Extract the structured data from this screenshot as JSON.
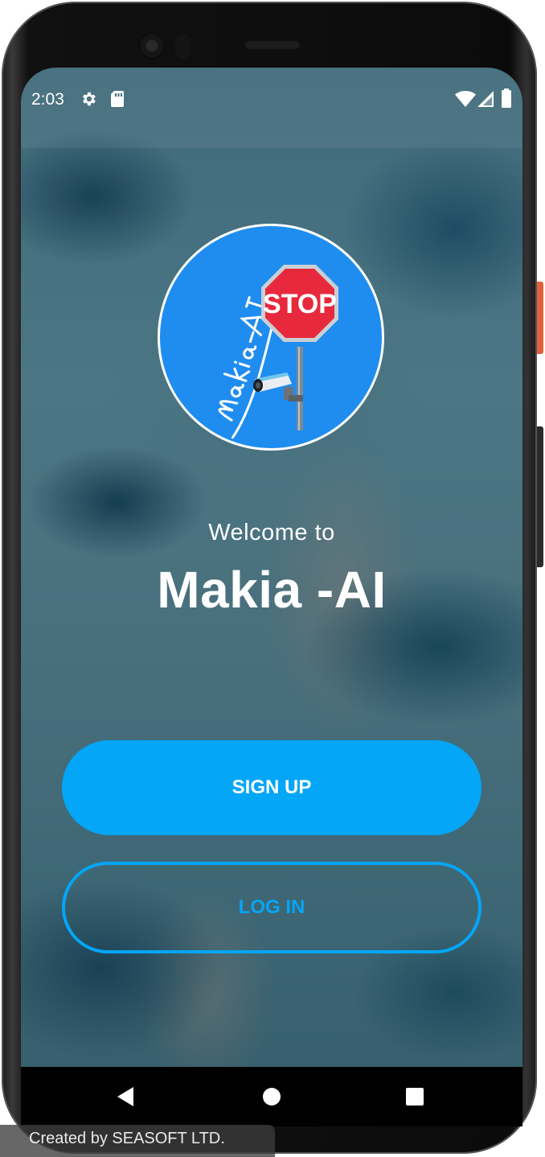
{
  "status_bar": {
    "time": "2:03",
    "icons_left": [
      "gear-icon",
      "sd-card-icon"
    ],
    "icons_right": [
      "wifi-icon",
      "signal-icon",
      "battery-icon"
    ]
  },
  "logo": {
    "stop_sign_text": "STOP",
    "script_text": "Makia-AI",
    "background_color": "#1f8df0"
  },
  "welcome": {
    "subtitle": "Welcome to",
    "title": "Makia -AI"
  },
  "buttons": {
    "signup_label": "SIGN UP",
    "login_label": "LOG IN"
  },
  "nav": {
    "icons": [
      "back-icon",
      "home-icon",
      "recents-icon"
    ]
  },
  "watermark": "Created by SEASOFT LTD.",
  "colors": {
    "accent": "#04a6f7",
    "stop_red": "#e8293d"
  }
}
